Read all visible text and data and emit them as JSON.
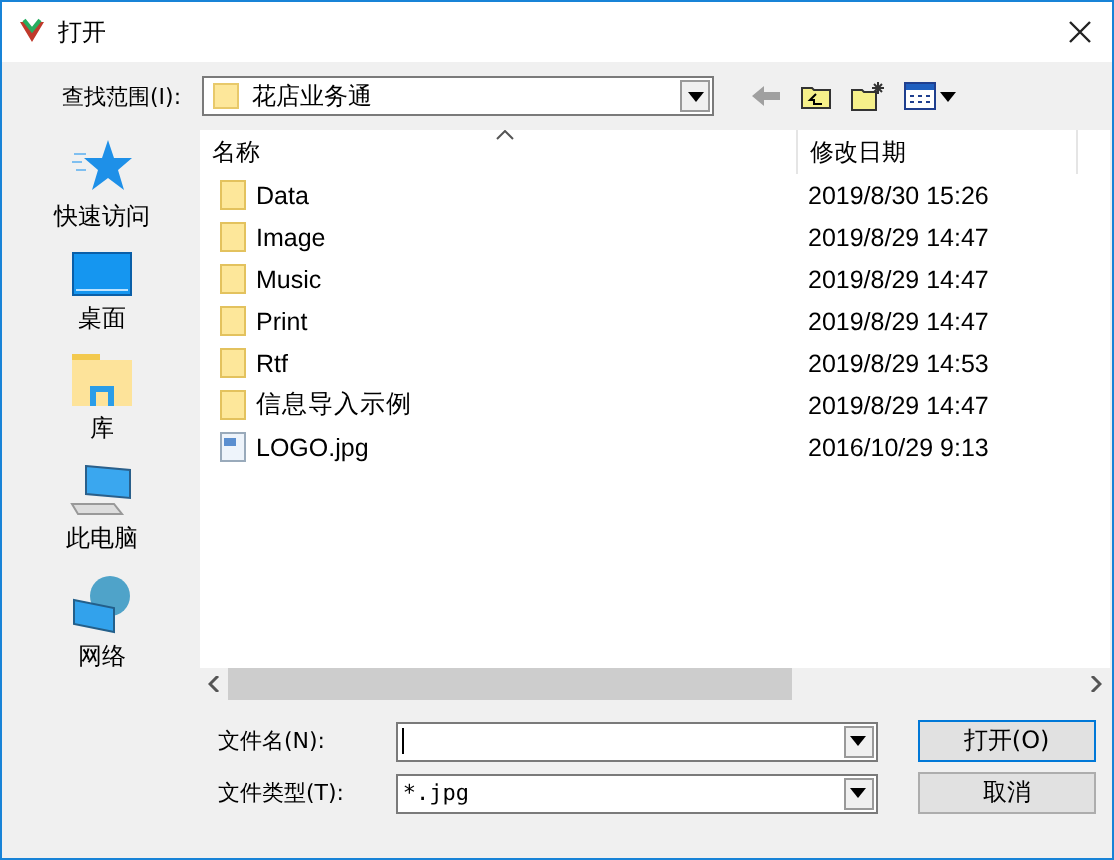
{
  "window": {
    "title": "打开"
  },
  "look_in": {
    "label": "查找范围(I):",
    "value": "花店业务通"
  },
  "places": [
    {
      "label": "快速访问",
      "kind": "quick"
    },
    {
      "label": "桌面",
      "kind": "desktop"
    },
    {
      "label": "库",
      "kind": "library"
    },
    {
      "label": "此电脑",
      "kind": "computer"
    },
    {
      "label": "网络",
      "kind": "network"
    }
  ],
  "columns": [
    "名称",
    "修改日期"
  ],
  "files": [
    {
      "name": "Data",
      "modified": "2019/8/30 15:26",
      "kind": "folder"
    },
    {
      "name": "Image",
      "modified": "2019/8/29 14:47",
      "kind": "folder"
    },
    {
      "name": "Music",
      "modified": "2019/8/29 14:47",
      "kind": "folder"
    },
    {
      "name": "Print",
      "modified": "2019/8/29 14:47",
      "kind": "folder"
    },
    {
      "name": "Rtf",
      "modified": "2019/8/29 14:53",
      "kind": "folder"
    },
    {
      "name": "信息导入示例",
      "modified": "2019/8/29 14:47",
      "kind": "folder"
    },
    {
      "name": "LOGO.jpg",
      "modified": "2016/10/29 9:13",
      "kind": "image"
    }
  ],
  "file_name": {
    "label": "文件名(N):"
  },
  "file_type": {
    "label": "文件类型(T):",
    "value": "*.jpg"
  },
  "buttons": [
    "打开(O)",
    "取消"
  ]
}
